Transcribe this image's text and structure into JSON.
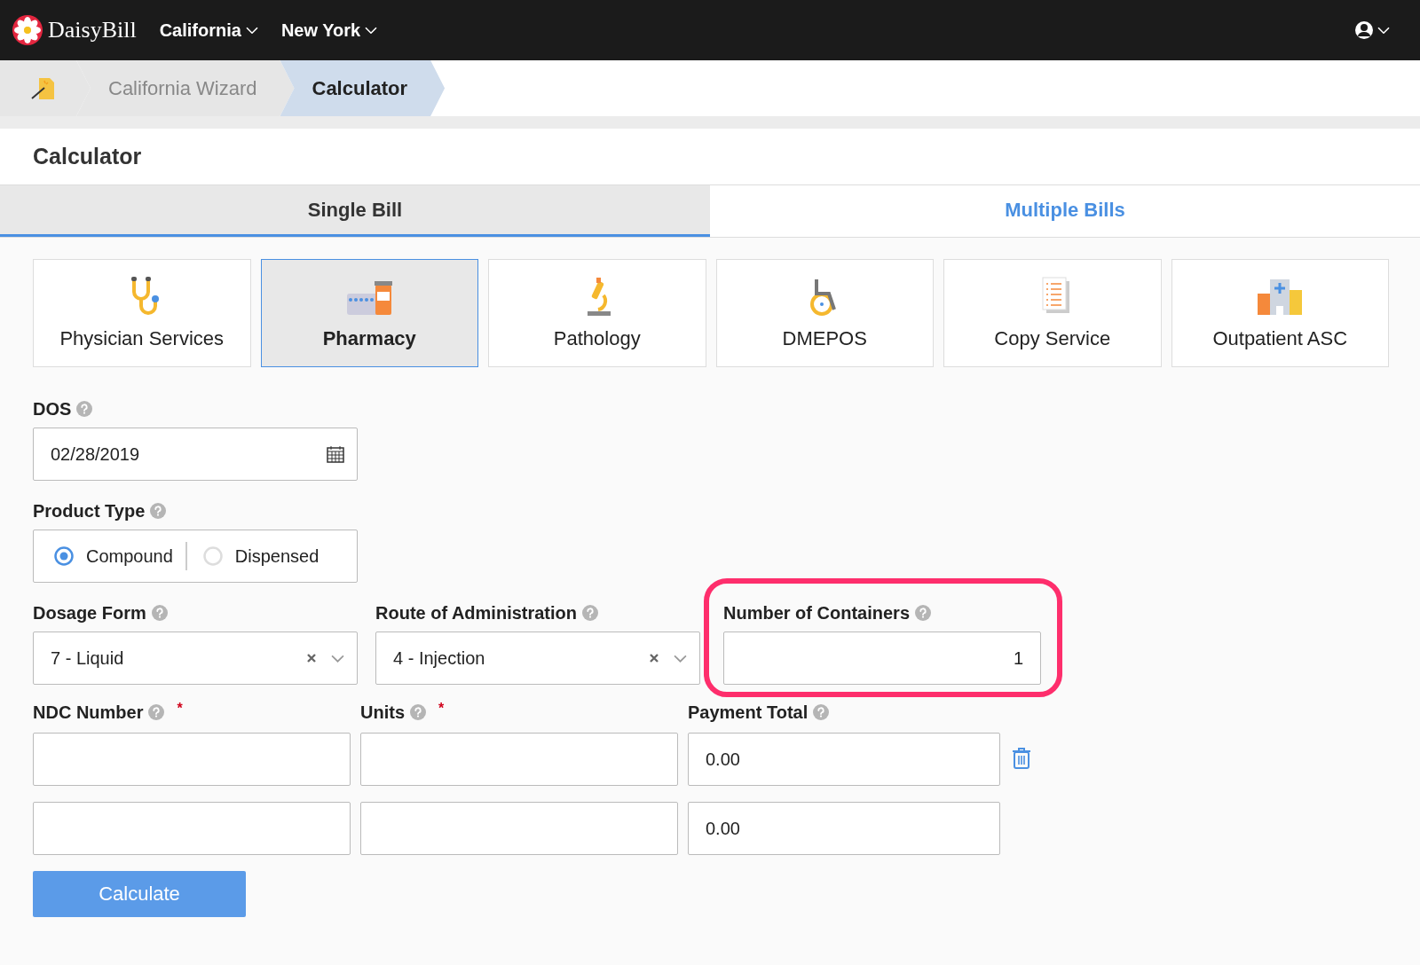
{
  "topbar": {
    "brand": "DaisyBill",
    "menus": [
      {
        "label": "California"
      },
      {
        "label": "New York"
      }
    ]
  },
  "breadcrumb": {
    "items": [
      {
        "label": "California Wizard",
        "selected": false
      },
      {
        "label": "Calculator",
        "selected": true
      }
    ]
  },
  "page_title": "Calculator",
  "tabs": [
    {
      "label": "Single Bill",
      "selected": true
    },
    {
      "label": "Multiple Bills",
      "selected": false
    }
  ],
  "services": [
    {
      "label": "Physician Services",
      "kind": "stethoscope",
      "selected": false
    },
    {
      "label": "Pharmacy",
      "kind": "pharmacy",
      "selected": true
    },
    {
      "label": "Pathology",
      "kind": "microscope",
      "selected": false
    },
    {
      "label": "DMEPOS",
      "kind": "wheelchair",
      "selected": false
    },
    {
      "label": "Copy Service",
      "kind": "document",
      "selected": false
    },
    {
      "label": "Outpatient ASC",
      "kind": "hospital",
      "selected": false
    }
  ],
  "form": {
    "dos": {
      "label": "DOS",
      "value": "02/28/2019"
    },
    "product_type": {
      "label": "Product Type",
      "options": [
        {
          "label": "Compound",
          "selected": true
        },
        {
          "label": "Dispensed",
          "selected": false
        }
      ]
    },
    "dosage_form": {
      "label": "Dosage Form",
      "value": "7 - Liquid"
    },
    "route": {
      "label": "Route of Administration",
      "value": "4 - Injection"
    },
    "containers": {
      "label": "Number of Containers",
      "value": "1",
      "highlighted": true
    },
    "line_columns": [
      {
        "label": "NDC Number",
        "required_mark": "*"
      },
      {
        "label": "Units",
        "required_mark": "*"
      },
      {
        "label": "Payment Total"
      }
    ],
    "line_rows": [
      {
        "payment_total": "0.00",
        "deletable": true
      },
      {
        "payment_total": "0.00",
        "deletable": false
      }
    ],
    "submit": "Calculate"
  }
}
